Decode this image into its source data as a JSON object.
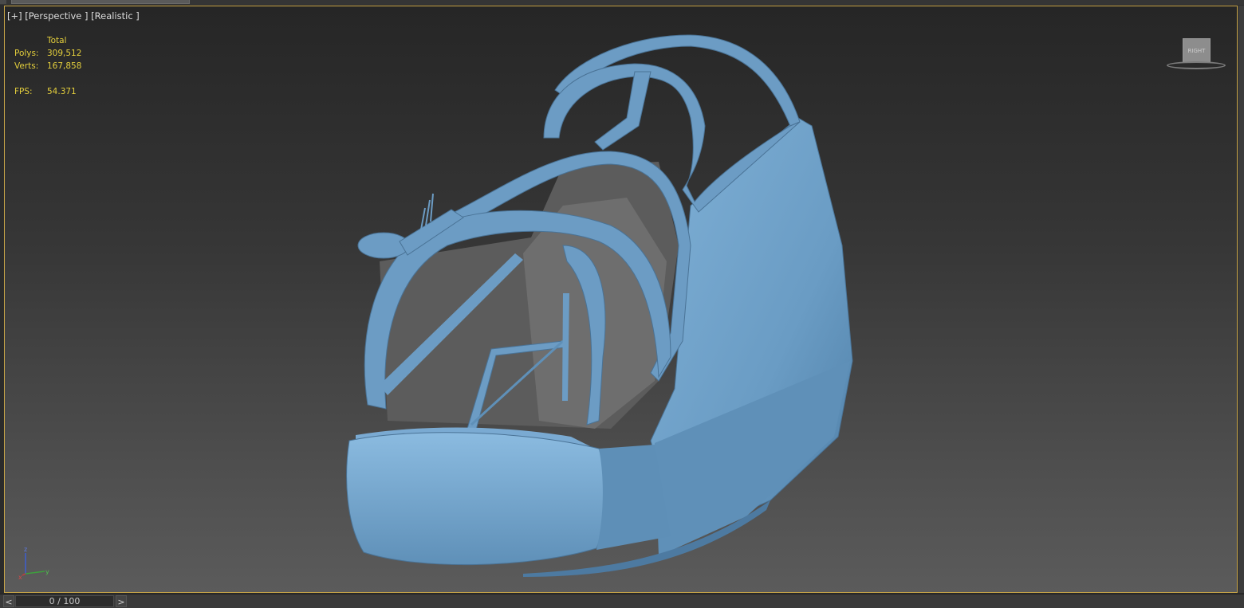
{
  "viewport": {
    "label_plus": "[+]",
    "label_view": "[Perspective ]",
    "label_shading": "[Realistic ]"
  },
  "stats": {
    "header": "Total",
    "polys_label": "Polys:",
    "polys_value": "309,512",
    "verts_label": "Verts:",
    "verts_value": "167,858",
    "fps_label": "FPS:",
    "fps_value": "54.371"
  },
  "viewcube": {
    "face_label": "RIGHT"
  },
  "axis": {
    "z": "z",
    "x": "x",
    "y": "y"
  },
  "timeline": {
    "prev_label": "<",
    "frame_display": "0 / 100",
    "next_label": ">"
  },
  "colors": {
    "viewport_border": "#c9a648",
    "stats_text": "#e4cf3c",
    "model_blue": "#6c9cc4"
  },
  "icons": [
    "viewcube-icon",
    "axis-tripod-icon"
  ]
}
